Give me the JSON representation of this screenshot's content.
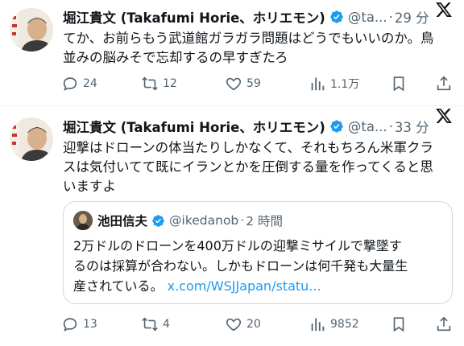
{
  "tweets": [
    {
      "author_name": "堀江貴文 (Takafumi Horie、ホリエモン)",
      "handle": "@ta...",
      "separator": "·",
      "time": "29 分",
      "text": "てか、お前らもう武道館ガラガラ問題はどうでもいいのか。鳥\n並みの脳みそで忘却するの早すぎたろ",
      "replies": "24",
      "reposts": "12",
      "likes": "59",
      "views": "1.1万"
    },
    {
      "author_name": "堀江貴文 (Takafumi Horie、ホリエモン)",
      "handle": "@ta...",
      "separator": "·",
      "time": "33 分",
      "text": "迎撃はドローンの体当たりしかなくて、それもちろん米軍クラ\nスは気付いてて既にイランとかを圧倒する量を作ってくると思\nいますよ",
      "replies": "13",
      "reposts": "4",
      "likes": "20",
      "views": "9852",
      "quote": {
        "author_name": "池田信夫",
        "handle": "@ikedanob",
        "separator": "·",
        "time": "2 時間",
        "text_line1": "2万ドルのドローンを400万ドルの迎撃ミサイルで撃墜す",
        "text_line2": "るのは採算が合わない。しかもドローンは何千発も大量生",
        "text_line3": "産されている。",
        "link": "x.com/WSJJapan/statu..."
      }
    }
  ],
  "colors": {
    "text": "#0f1419",
    "secondary": "#536471",
    "verified": "#1d9bf0",
    "link": "#1d9bf0",
    "border": "#cfd9de"
  },
  "icons": [
    "x-logo-icon",
    "verified-badge-icon",
    "reply-icon",
    "repost-icon",
    "like-icon",
    "views-icon",
    "bookmark-icon",
    "share-icon"
  ]
}
